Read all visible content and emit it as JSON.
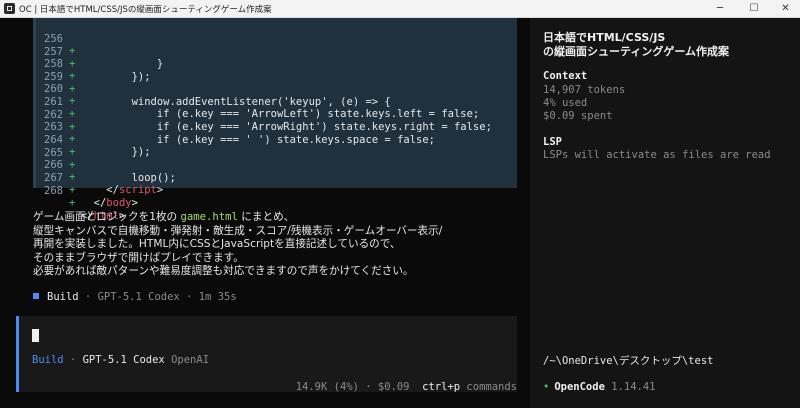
{
  "window": {
    "title": "OC | 日本語でHTML/CSS/JSの縦画面シューティングゲーム作成案",
    "controls": {
      "minimize": "─",
      "maximize": "☐",
      "close": "✕"
    }
  },
  "code": {
    "lines": [
      {
        "num": "256",
        "mark": "+",
        "text": "            }"
      },
      {
        "num": "257",
        "mark": "+",
        "text": "        });"
      },
      {
        "num": "258",
        "mark": "+",
        "text": ""
      },
      {
        "num": "259",
        "mark": "+",
        "text": "        window.addEventListener('keyup', (e) => {"
      },
      {
        "num": "260",
        "mark": "+",
        "text": "            if (e.key === 'ArrowLeft') state.keys.left = false;"
      },
      {
        "num": "261",
        "mark": "+",
        "text": "            if (e.key === 'ArrowRight') state.keys.right = false;"
      },
      {
        "num": "262",
        "mark": "+",
        "text": "            if (e.key === ' ') state.keys.space = false;"
      },
      {
        "num": "263",
        "mark": "+",
        "text": "        });"
      },
      {
        "num": "264",
        "mark": "+",
        "text": ""
      },
      {
        "num": "265",
        "mark": "+",
        "text": "        loop();"
      },
      {
        "num": "266",
        "mark": "+",
        "text_pre": "    </",
        "tag": "script",
        "text_post": ">"
      },
      {
        "num": "267",
        "mark": "+",
        "text_pre": "  </",
        "tag": "body",
        "text_post": ">"
      },
      {
        "num": "268",
        "mark": "+",
        "text_pre": "</",
        "tag": "html",
        "text_post": ">"
      }
    ]
  },
  "message": {
    "line1_pre": "ゲーム画面とロジックを1枚の ",
    "line1_code": "game.html",
    "line1_post": " にまとめ、",
    "line2": "縦型キャンバスで自機移動・弾発射・敵生成・スコア/残機表示・ゲームオーバー表示/",
    "line3": "再開を実装しました。HTML内にCSSとJavaScriptを直接記述しているので、",
    "line4": "そのままブラウザで開けばプレイできます。",
    "line5": "必要があれば敵パターンや難易度調整も対応できますので声をかけてください。"
  },
  "build_info": {
    "agent": "Build",
    "sep1": " · ",
    "model": "GPT-5.1 Codex",
    "sep2": " · ",
    "duration": "1m 35s"
  },
  "input": {
    "agent": "Build",
    "sep": " · ",
    "model": "GPT-5.1 Codex",
    "provider": "OpenAI"
  },
  "status": {
    "tokens": "14.9K (4%)",
    "sep": " · ",
    "cost": "$0.09",
    "shortcut": "ctrl+p",
    "shortcut_label": "commands"
  },
  "sidebar": {
    "title_line1": "日本語でHTML/CSS/JS",
    "title_line2": "の縦画面シューティングゲーム作成案",
    "context_heading": "Context",
    "context_tokens": "14,907 tokens",
    "context_used": "4% used",
    "context_spent": "$0.09 spent",
    "lsp_heading": "LSP",
    "lsp_text": "LSPs will activate as files are read",
    "path": "/~\\OneDrive\\デスクトップ\\test",
    "app_dot": "•",
    "app_name": "OpenCode",
    "app_version": "1.14.41"
  }
}
